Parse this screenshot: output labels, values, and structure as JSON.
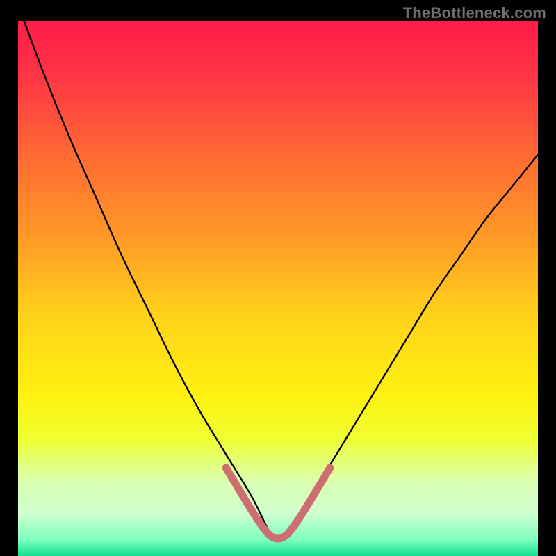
{
  "watermark": "TheBottleneck.com",
  "chart_data": {
    "type": "line",
    "title": "",
    "xlabel": "",
    "ylabel": "",
    "xlim": [
      0,
      100
    ],
    "ylim": [
      0,
      100
    ],
    "grid": false,
    "series": [
      {
        "name": "curve",
        "x": [
          0,
          5,
          10,
          15,
          20,
          25,
          30,
          35,
          40,
          45,
          49,
          51,
          55,
          60,
          65,
          70,
          75,
          80,
          85,
          90,
          95,
          100
        ],
        "values": [
          103,
          90,
          78,
          67,
          56,
          46,
          36,
          27,
          19,
          11,
          3.5,
          3.5,
          9,
          17,
          25,
          33,
          41,
          49,
          56,
          63,
          69,
          75
        ]
      },
      {
        "name": "highlight",
        "x": [
          40,
          44,
          47,
          49,
          51,
          53,
          56,
          60
        ],
        "values": [
          16.5,
          10,
          5.5,
          3.5,
          3.5,
          5.5,
          10,
          16.5
        ]
      }
    ],
    "annotations": [],
    "gradient_stops": [
      {
        "offset": 0.0,
        "color": "#ff1c4a"
      },
      {
        "offset": 0.1,
        "color": "#ff3445"
      },
      {
        "offset": 0.25,
        "color": "#ff6a34"
      },
      {
        "offset": 0.4,
        "color": "#ff9827"
      },
      {
        "offset": 0.55,
        "color": "#ffd21a"
      },
      {
        "offset": 0.7,
        "color": "#fff110"
      },
      {
        "offset": 0.78,
        "color": "#f0ff30"
      },
      {
        "offset": 0.86,
        "color": "#daffb0"
      },
      {
        "offset": 0.92,
        "color": "#d0ffd0"
      },
      {
        "offset": 0.97,
        "color": "#7cffbe"
      },
      {
        "offset": 1.0,
        "color": "#11e090"
      }
    ],
    "line_style": {
      "curve_color": "#000000",
      "curve_width": 2.4,
      "highlight_color": "#cd6f70",
      "highlight_width": 11
    }
  }
}
